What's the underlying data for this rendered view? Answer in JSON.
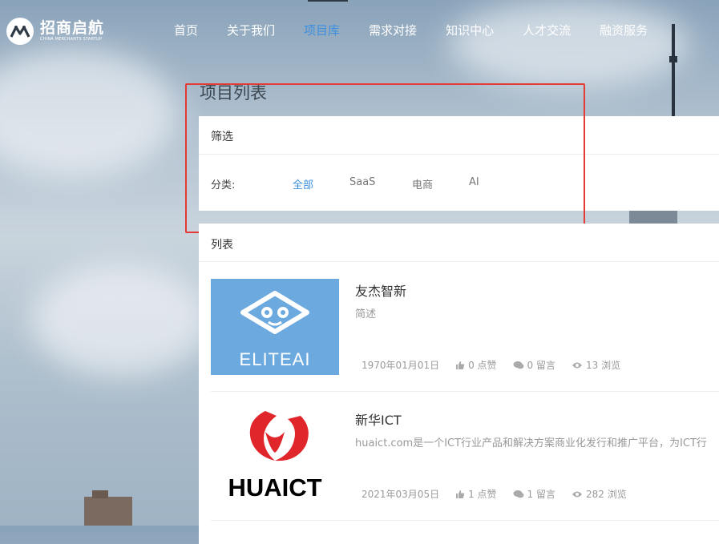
{
  "brand": {
    "name_cn": "招商启航",
    "name_en": "CHINA MERCHANTS STARTUP"
  },
  "nav": [
    {
      "label": "首页",
      "active": false
    },
    {
      "label": "关于我们",
      "active": false
    },
    {
      "label": "项目库",
      "active": true
    },
    {
      "label": "需求对接",
      "active": false
    },
    {
      "label": "知识中心",
      "active": false
    },
    {
      "label": "人才交流",
      "active": false
    },
    {
      "label": "融资服务",
      "active": false
    }
  ],
  "page": {
    "title": "项目列表"
  },
  "filter": {
    "header": "筛选",
    "category_label": "分类:",
    "options": [
      {
        "label": "全部",
        "active": true
      },
      {
        "label": "SaaS",
        "active": false
      },
      {
        "label": "电商",
        "active": false
      },
      {
        "label": "AI",
        "active": false
      }
    ]
  },
  "list": {
    "header": "列表",
    "items": [
      {
        "title": "友杰智新",
        "desc": "简述",
        "date": "1970年01月01日",
        "likes": "0 点赞",
        "comments": "0 留言",
        "views": "13 浏览",
        "logo_text": "ELITEAI"
      },
      {
        "title": "新华ICT",
        "desc": "huaict.com是一个ICT行业产品和解决方案商业化发行和推广平台，为ICT行",
        "date": "2021年03月05日",
        "likes": "1 点赞",
        "comments": "1 留言",
        "views": "282 浏览",
        "logo_text": "HUAICT"
      }
    ]
  },
  "colors": {
    "accent": "#3d8fe0",
    "highlight": "#e53a33",
    "elite_bg": "#6ba9de",
    "huaict_red": "#e0252b"
  }
}
